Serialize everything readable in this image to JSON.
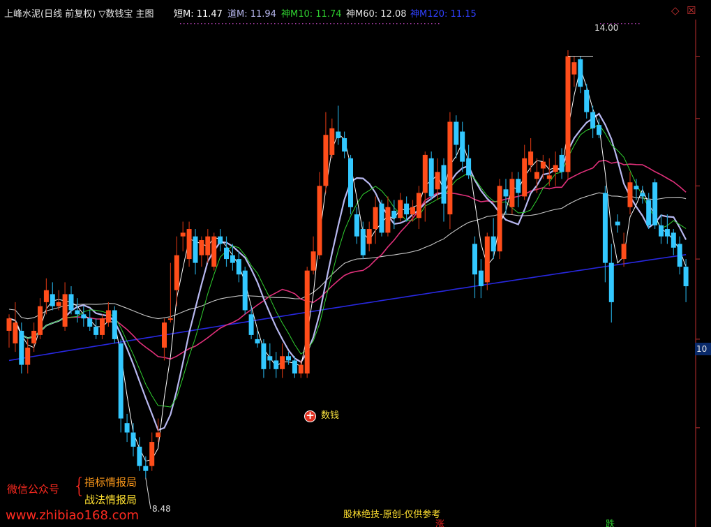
{
  "header": {
    "title": "上峰水泥(日线 前复权) ▽数钱宝 主图",
    "ma_items": [
      {
        "label": "短M: 11.47",
        "color": "#ffffff"
      },
      {
        "label": "道M: 11.94",
        "color": "#b8b8f0"
      },
      {
        "label": "神M10: 11.74",
        "color": "#30d030"
      },
      {
        "label": "神M60: 12.08",
        "color": "#e0e0e0"
      },
      {
        "label": "神M120: 11.15",
        "color": "#3040ff"
      }
    ]
  },
  "window_controls": {
    "diamond": "◇",
    "close": "☒"
  },
  "annotations": {
    "high_price": "14.00",
    "low_price": "8.48",
    "signal_label": "数钱",
    "signal_icon": "plus-circle-icon",
    "axis_value": "10"
  },
  "watermark": {
    "left": "微信公众号",
    "brace": "{",
    "line1": "指标情报局",
    "line2": "战法情报局",
    "url": "www.zhibiao168.com"
  },
  "footer": {
    "caption": "股林绝技-原创-仅供参考",
    "mark_rise": "涨",
    "mark_fall": "跌"
  },
  "colors": {
    "background": "#000000",
    "up_candle": "#ff4d1a",
    "down_candle": "#33c8ff",
    "ma_short": "#ffffff",
    "ma_dao": "#b8b8f0",
    "ma10": "#30d030",
    "ma20": "#e0307a",
    "ma60": "#c8c8c8",
    "ma120": "#2828e0",
    "axis": "#c03030"
  },
  "chart_data": {
    "type": "candlestick",
    "y_scale": "log",
    "ylim": [
      8.2,
      14.6
    ],
    "high_marker": 14.0,
    "low_marker": 8.48,
    "axis_value": 10,
    "candles": [
      [
        10.1,
        10.25,
        9.9,
        10.3
      ],
      [
        9.95,
        10.2,
        9.85,
        10.45
      ],
      [
        10.1,
        9.7,
        9.6,
        10.2
      ],
      [
        9.7,
        9.9,
        9.6,
        10.0
      ],
      [
        9.95,
        10.1,
        9.85,
        10.2
      ],
      [
        10.05,
        10.4,
        10.0,
        10.5
      ],
      [
        10.45,
        10.6,
        10.3,
        10.75
      ],
      [
        10.55,
        10.4,
        10.35,
        10.7
      ],
      [
        10.4,
        10.45,
        10.35,
        10.6
      ],
      [
        10.15,
        10.55,
        10.1,
        10.7
      ],
      [
        10.55,
        10.35,
        10.3,
        10.65
      ],
      [
        10.35,
        10.3,
        10.2,
        10.5
      ],
      [
        10.3,
        10.25,
        10.15,
        10.4
      ],
      [
        10.25,
        10.15,
        10.1,
        10.35
      ],
      [
        10.15,
        10.05,
        10.0,
        10.25
      ],
      [
        10.05,
        10.25,
        10.0,
        10.3
      ],
      [
        10.2,
        10.35,
        10.15,
        10.45
      ],
      [
        10.35,
        10.0,
        9.95,
        10.4
      ],
      [
        9.95,
        9.1,
        8.95,
        10.0
      ],
      [
        9.05,
        8.95,
        8.85,
        9.15
      ],
      [
        8.95,
        8.8,
        8.7,
        9.05
      ],
      [
        8.8,
        8.6,
        8.55,
        8.9
      ],
      [
        8.6,
        8.55,
        8.48,
        8.7
      ],
      [
        8.6,
        8.85,
        8.55,
        8.95
      ],
      [
        8.9,
        8.95,
        8.85,
        9.1
      ],
      [
        9.9,
        10.2,
        9.75,
        10.25
      ],
      [
        10.25,
        10.25,
        10.2,
        10.95
      ],
      [
        10.6,
        11.05,
        10.4,
        11.3
      ],
      [
        11.3,
        11.35,
        11.1,
        11.5
      ],
      [
        11.0,
        11.4,
        10.9,
        11.5
      ],
      [
        11.3,
        10.95,
        10.8,
        11.4
      ],
      [
        11.05,
        11.25,
        10.9,
        11.3
      ],
      [
        11.05,
        11.3,
        10.95,
        11.4
      ],
      [
        10.9,
        11.3,
        10.85,
        11.35
      ],
      [
        11.3,
        11.2,
        11.1,
        11.4
      ],
      [
        11.15,
        11.0,
        10.9,
        11.3
      ],
      [
        11.05,
        10.95,
        10.85,
        11.2
      ],
      [
        11.0,
        10.8,
        10.7,
        11.1
      ],
      [
        10.85,
        10.35,
        10.3,
        10.9
      ],
      [
        10.3,
        10.05,
        10.0,
        10.4
      ],
      [
        10.0,
        9.95,
        9.9,
        10.1
      ],
      [
        9.95,
        9.65,
        9.55,
        10.0
      ],
      [
        9.8,
        9.75,
        9.65,
        9.95
      ],
      [
        9.75,
        9.65,
        9.55,
        9.85
      ],
      [
        9.65,
        9.8,
        9.55,
        9.95
      ],
      [
        9.8,
        9.75,
        9.7,
        9.85
      ],
      [
        9.75,
        9.6,
        9.55,
        9.8
      ],
      [
        9.6,
        9.7,
        9.55,
        9.75
      ],
      [
        9.6,
        10.85,
        9.55,
        10.9
      ],
      [
        10.85,
        11.1,
        10.8,
        11.3
      ],
      [
        11.05,
        12.0,
        11.0,
        12.2
      ],
      [
        12.0,
        12.75,
        11.9,
        13.1
      ],
      [
        12.45,
        12.85,
        12.4,
        13.0
      ],
      [
        12.8,
        12.7,
        12.6,
        13.2
      ],
      [
        12.7,
        12.5,
        12.4,
        12.8
      ],
      [
        12.4,
        11.7,
        11.6,
        12.45
      ],
      [
        11.6,
        11.3,
        11.2,
        11.7
      ],
      [
        11.4,
        11.05,
        11.0,
        11.5
      ],
      [
        11.2,
        11.4,
        11.1,
        11.5
      ],
      [
        11.4,
        11.7,
        11.2,
        11.85
      ],
      [
        11.75,
        11.35,
        11.3,
        11.8
      ],
      [
        11.35,
        11.7,
        11.3,
        11.85
      ],
      [
        11.65,
        11.55,
        11.4,
        11.8
      ],
      [
        11.55,
        11.8,
        11.5,
        11.9
      ],
      [
        11.75,
        11.6,
        11.5,
        11.85
      ],
      [
        11.6,
        11.7,
        11.5,
        11.8
      ],
      [
        11.55,
        11.9,
        11.4,
        12.0
      ],
      [
        11.9,
        12.45,
        11.5,
        12.5
      ],
      [
        12.4,
        11.85,
        11.8,
        12.5
      ],
      [
        11.95,
        12.2,
        11.8,
        12.4
      ],
      [
        12.3,
        11.75,
        11.5,
        12.4
      ],
      [
        11.6,
        12.95,
        11.4,
        13.1
      ],
      [
        12.95,
        12.6,
        12.4,
        13.05
      ],
      [
        12.8,
        12.35,
        12.2,
        12.95
      ],
      [
        12.4,
        12.15,
        12.1,
        12.6
      ],
      [
        11.2,
        10.8,
        10.5,
        11.3
      ],
      [
        10.85,
        10.65,
        10.5,
        11.0
      ],
      [
        10.7,
        11.3,
        10.6,
        11.35
      ],
      [
        11.3,
        11.1,
        11.0,
        11.55
      ],
      [
        11.1,
        12.0,
        11.0,
        12.1
      ],
      [
        11.95,
        11.85,
        11.6,
        12.1
      ],
      [
        11.7,
        12.1,
        11.6,
        12.2
      ],
      [
        12.1,
        11.9,
        11.7,
        12.2
      ],
      [
        11.85,
        12.4,
        11.8,
        12.6
      ],
      [
        12.3,
        12.5,
        12.2,
        12.7
      ],
      [
        12.1,
        12.2,
        11.9,
        12.4
      ],
      [
        12.25,
        12.35,
        12.1,
        12.45
      ],
      [
        12.1,
        12.15,
        12.0,
        12.4
      ],
      [
        12.2,
        12.3,
        12.0,
        12.5
      ],
      [
        12.45,
        12.2,
        12.1,
        12.55
      ],
      [
        12.2,
        14.0,
        12.1,
        14.1
      ],
      [
        13.7,
        13.9,
        13.5,
        14.0
      ],
      [
        13.95,
        13.5,
        13.4,
        14.0
      ],
      [
        13.45,
        13.1,
        13.0,
        13.55
      ],
      [
        13.1,
        12.85,
        12.7,
        13.2
      ],
      [
        12.9,
        12.75,
        12.7,
        13.0
      ],
      [
        11.9,
        10.95,
        10.7,
        12.0
      ],
      [
        10.95,
        10.45,
        10.2,
        11.2
      ],
      [
        11.5,
        11.45,
        11.35,
        11.6
      ],
      [
        11.0,
        11.2,
        10.9,
        11.35
      ],
      [
        11.7,
        12.05,
        11.6,
        12.2
      ],
      [
        12.0,
        11.95,
        11.8,
        12.1
      ],
      [
        11.9,
        11.85,
        11.75,
        12.0
      ],
      [
        11.8,
        11.45,
        11.4,
        11.9
      ],
      [
        12.05,
        11.45,
        11.4,
        12.1
      ],
      [
        11.45,
        11.3,
        11.2,
        11.6
      ],
      [
        11.4,
        11.3,
        11.2,
        11.6
      ],
      [
        11.35,
        11.15,
        11.05,
        11.4
      ],
      [
        11.2,
        10.9,
        10.8,
        11.3
      ],
      [
        10.9,
        10.65,
        10.45,
        11.0
      ]
    ]
  }
}
